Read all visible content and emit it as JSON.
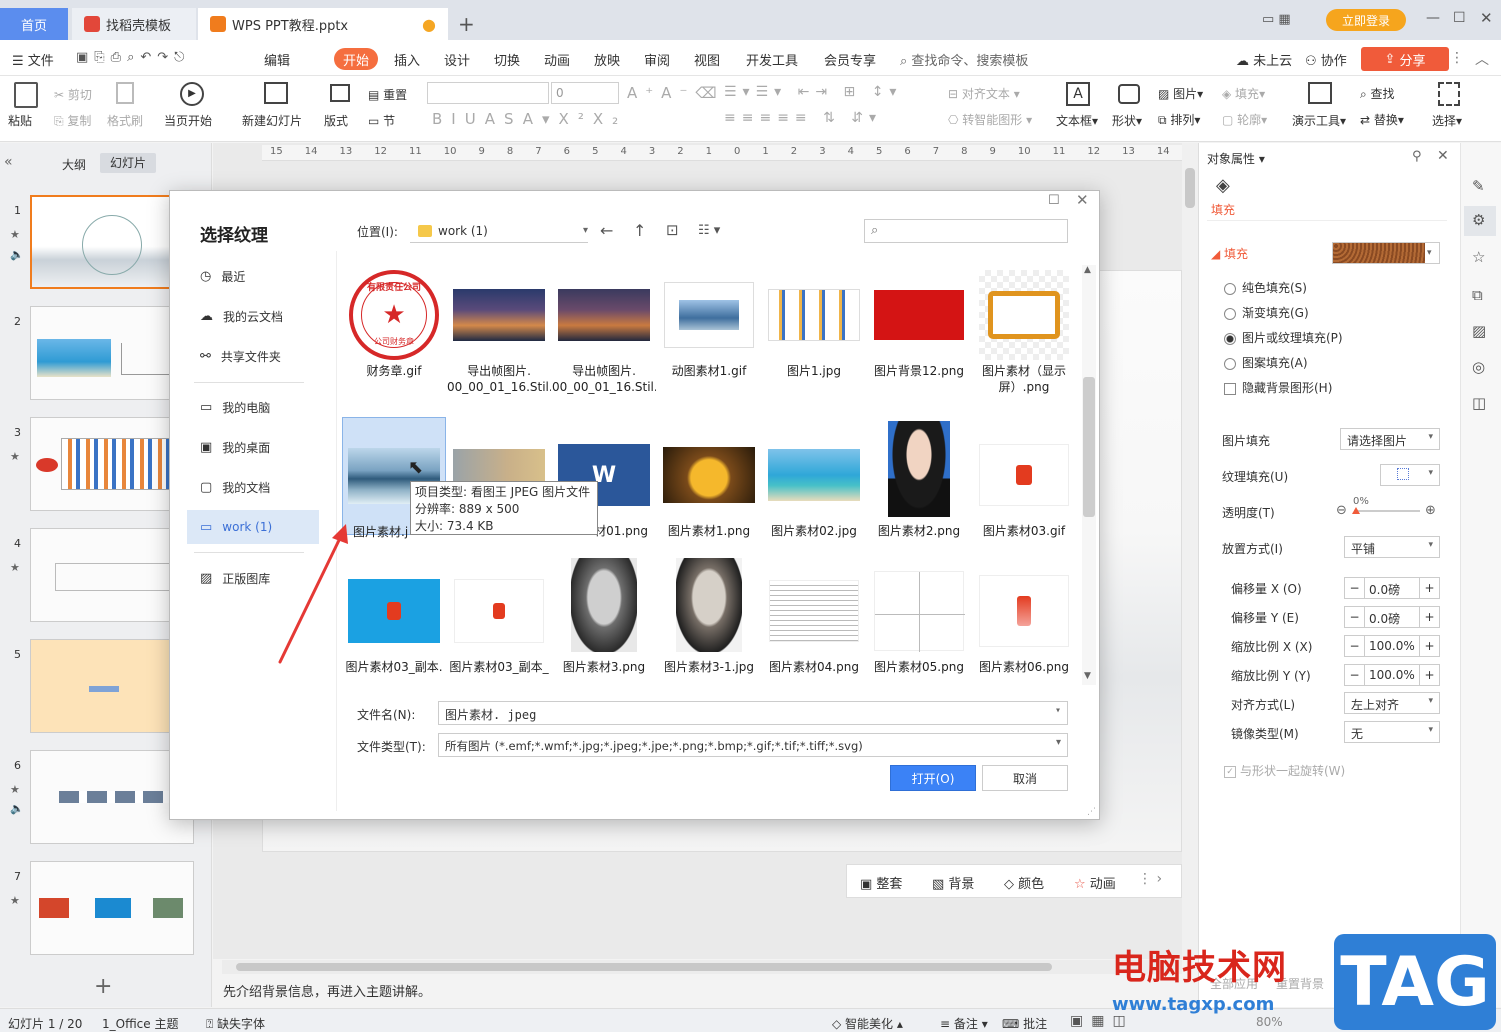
{
  "titlebar": {
    "tab_home": "首页",
    "tab_templates": "找稻壳模板",
    "tab_doc": "WPS PPT教程.pptx",
    "login": "立即登录"
  },
  "menubar": {
    "file": "文件",
    "edit": "编辑",
    "items": [
      "开始",
      "插入",
      "设计",
      "切换",
      "动画",
      "放映",
      "审阅",
      "视图",
      "开发工具",
      "会员专享"
    ],
    "search": "查找命令、搜索模板",
    "cloud": "未上云",
    "collab": "协作",
    "share": "分享"
  },
  "ribbon": {
    "paste": "粘贴",
    "cut": "剪切",
    "copy": "复制",
    "format_painter": "格式刷",
    "from_current": "当页开始",
    "new_slide": "新建幻灯片",
    "layout": "版式",
    "reset": "重置",
    "section": "节",
    "font_size": "0",
    "align_text": "对齐文本",
    "smart_art": "转智能图形",
    "textbox": "文本框",
    "shape": "形状",
    "picture": "图片",
    "fill": "填充",
    "arrange": "排列",
    "outline": "轮廓",
    "presentation_tools": "演示工具",
    "find": "查找",
    "replace": "替换",
    "select": "选择"
  },
  "leftpanel": {
    "tab_outline": "大纲",
    "tab_slides": "幻灯片",
    "slide_numbers": [
      "1",
      "2",
      "3",
      "4",
      "5",
      "6",
      "7"
    ]
  },
  "ruler": {
    "ticks": [
      "15",
      "14",
      "13",
      "12",
      "11",
      "10",
      "9",
      "8",
      "7",
      "6",
      "5",
      "4",
      "3",
      "2",
      "1",
      "0",
      "1",
      "2",
      "3",
      "4",
      "5",
      "6",
      "7",
      "8",
      "9",
      "10",
      "11",
      "12",
      "13",
      "14"
    ]
  },
  "slide_tools": {
    "tidy": "整套",
    "background": "背景",
    "color": "颜色",
    "animation": "动画"
  },
  "notes": "先介绍背景信息，再进入主题讲解。",
  "status": {
    "slide_counter": "幻灯片 1 / 20",
    "theme": "1_Office 主题",
    "missing_font": "缺失字体",
    "beautify": "智能美化",
    "notes": "备注",
    "comments": "批注",
    "zoom": "80%"
  },
  "rightpanel": {
    "header": "对象属性",
    "tab_fill": "填充",
    "section_fill": "填充",
    "opt_solid": "纯色填充(S)",
    "opt_gradient": "渐变填充(G)",
    "opt_picture": "图片或纹理填充(P)",
    "opt_pattern": "图案填充(A)",
    "opt_hide": "隐藏背景图形(H)",
    "picture_fill_label": "图片填充",
    "picture_fill_value": "请选择图片",
    "texture_fill_label": "纹理填充(U)",
    "transparency_label": "透明度(T)",
    "transparency_value": "0%",
    "placement_label": "放置方式(I)",
    "placement_value": "平铺",
    "offset_x_label": "偏移量 X (O)",
    "offset_x_value": "0.0磅",
    "offset_y_label": "偏移量 Y (E)",
    "offset_y_value": "0.0磅",
    "scale_x_label": "缩放比例 X (X)",
    "scale_x_value": "100.0%",
    "scale_y_label": "缩放比例 Y (Y)",
    "scale_y_value": "100.0%",
    "align_label": "对齐方式(L)",
    "align_value": "左上对齐",
    "mirror_label": "镜像类型(M)",
    "mirror_value": "无",
    "rotate_with_shape": "与形状一起旋转(W)",
    "apply_all": "全部应用",
    "reset_bg": "重置背景"
  },
  "dialog": {
    "title": "选择纹理",
    "location_label": "位置(I):",
    "location_value": "work (1)",
    "nav": [
      {
        "label": "最近"
      },
      {
        "label": "我的云文档"
      },
      {
        "label": "共享文件夹"
      },
      {
        "label": "我的电脑"
      },
      {
        "label": "我的桌面"
      },
      {
        "label": "我的文档"
      },
      {
        "label": "work (1)"
      },
      {
        "label": "正版图库"
      }
    ],
    "files": [
      {
        "name1": "财务章.gif",
        "name2": ""
      },
      {
        "name1": "导出帧图片.",
        "name2": "00_00_01_16.Stil..."
      },
      {
        "name1": "导出帧图片.",
        "name2": "00_00_01_16.Stil..."
      },
      {
        "name1": "动图素材1.gif",
        "name2": ""
      },
      {
        "name1": "图片1.jpg",
        "name2": ""
      },
      {
        "name1": "图片背景12.png",
        "name2": ""
      },
      {
        "name1": "图片素材（显示",
        "name2": "屏）.png"
      },
      {
        "name1": "图片素材.j",
        "name2": ""
      },
      {
        "name1": "",
        "name2": ""
      },
      {
        "name1": "材01.png",
        "name2": ""
      },
      {
        "name1": "图片素材1.png",
        "name2": ""
      },
      {
        "name1": "图片素材02.jpg",
        "name2": ""
      },
      {
        "name1": "图片素材2.png",
        "name2": ""
      },
      {
        "name1": "图片素材03.gif",
        "name2": ""
      },
      {
        "name1": "图片素材03_副本.",
        "name2": ""
      },
      {
        "name1": "图片素材03_副本_",
        "name2": ""
      },
      {
        "name1": "图片素材3.png",
        "name2": ""
      },
      {
        "name1": "图片素材3-1.jpg",
        "name2": ""
      },
      {
        "name1": "图片素材04.png",
        "name2": ""
      },
      {
        "name1": "图片素材05.png",
        "name2": ""
      },
      {
        "name1": "图片素材06.png",
        "name2": ""
      }
    ],
    "stamp_text": "有限责任公司",
    "stamp_bottom": "公司财务章",
    "tooltip_type": "项目类型: 看图王 JPEG 图片文件",
    "tooltip_res": "分辨率: 889 x 500",
    "tooltip_size": "大小: 73.4 KB",
    "filename_label": "文件名(N):",
    "filename_value": "图片素材. jpeg",
    "filetype_label": "文件类型(T):",
    "filetype_value": "所有图片 (*.emf;*.wmf;*.jpg;*.jpeg;*.jpe;*.png;*.bmp;*.gif;*.tif;*.tiff;*.svg)",
    "open": "打开(O)",
    "cancel": "取消"
  },
  "watermark": {
    "text": "电脑技术网",
    "url": "www.tagxp.com",
    "tag": "TAG"
  },
  "colors": {
    "accent_orange": "#f56e3f",
    "primary_blue": "#3b82f6",
    "annotation_red": "#e53935"
  }
}
